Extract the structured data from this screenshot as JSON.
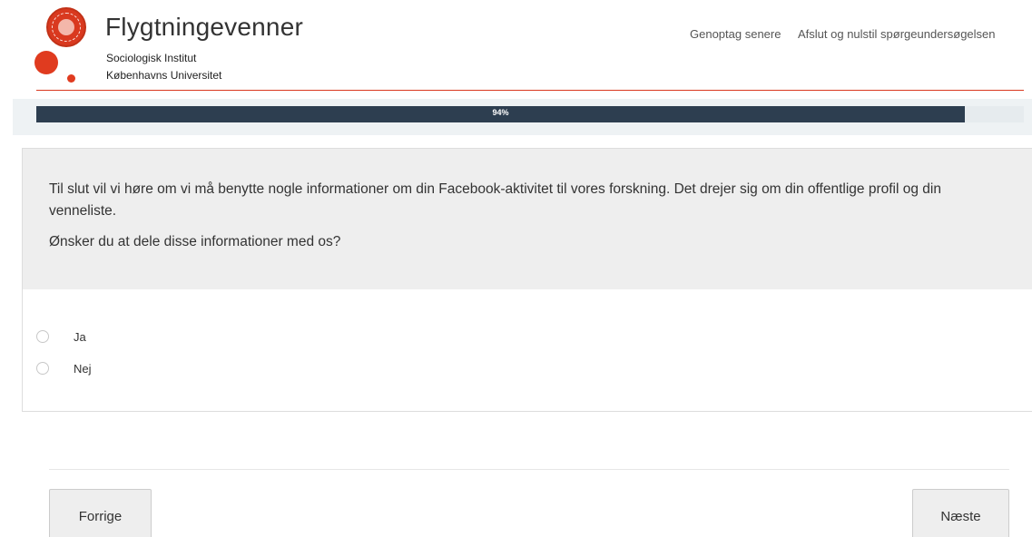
{
  "header": {
    "title": "Flygtningevenner",
    "subtitle_institute": "Sociologisk Institut",
    "subtitle_university": "Københavns Universitet",
    "links": {
      "resume_later": "Genoptag senere",
      "exit_reset": "Afslut og nulstil spørgeundersøgelsen"
    },
    "logo_icon": "university-seal-icon",
    "accent_color": "#d9391f"
  },
  "progress": {
    "percent": 94,
    "label": "94%",
    "fill_color": "#2d3e50"
  },
  "question": {
    "text": "Til slut vil vi høre om vi må benytte nogle informationer om din Facebook-aktivitet til vores forskning. Det drejer sig om din offentlige profil og din venneliste.",
    "prompt": "Ønsker du at dele disse informationer med os?",
    "options": [
      {
        "label": "Ja",
        "selected": false
      },
      {
        "label": "Nej",
        "selected": false
      }
    ]
  },
  "navigation": {
    "previous_label": "Forrige",
    "next_label": "Næste"
  }
}
